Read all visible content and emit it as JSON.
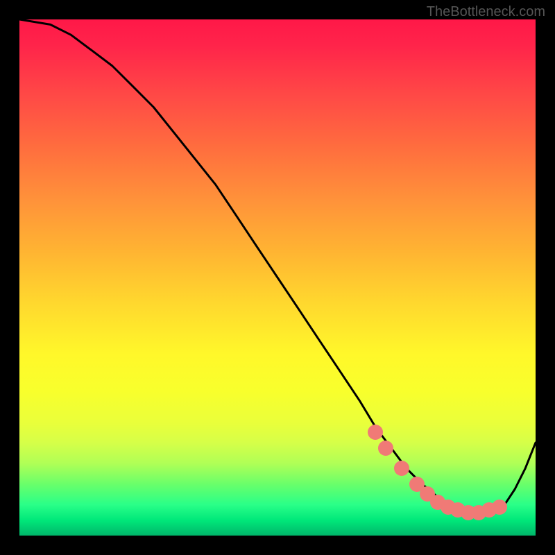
{
  "watermark": "TheBottleneck.com",
  "chart_data": {
    "type": "line",
    "title": "",
    "xlabel": "",
    "ylabel": "",
    "xlim": [
      0,
      100
    ],
    "ylim": [
      0,
      100
    ],
    "series": [
      {
        "name": "curve",
        "x": [
          0,
          6,
          10,
          14,
          18,
          22,
          26,
          30,
          34,
          38,
          42,
          46,
          50,
          54,
          58,
          62,
          66,
          69,
          72,
          75,
          78,
          81,
          84,
          86,
          88,
          90,
          92,
          94,
          96,
          98,
          100
        ],
        "values": [
          100,
          99,
          97,
          94,
          91,
          87,
          83,
          78,
          73,
          68,
          62,
          56,
          50,
          44,
          38,
          32,
          26,
          21,
          17,
          13,
          10,
          7.5,
          5.5,
          4.5,
          4,
          4,
          4.5,
          6,
          9,
          13,
          18
        ]
      }
    ],
    "markers": {
      "name": "highlight-dots",
      "x": [
        69,
        71,
        74,
        77,
        79,
        81,
        83,
        85,
        87,
        89,
        91,
        93
      ],
      "values": [
        20,
        17,
        13,
        10,
        8,
        6.5,
        5.5,
        5,
        4.5,
        4.5,
        5,
        5.5
      ]
    },
    "gradient_stops": [
      {
        "pos": 0,
        "color": "#ff1848"
      },
      {
        "pos": 50,
        "color": "#ffd82e"
      },
      {
        "pos": 90,
        "color": "#6aff6a"
      },
      {
        "pos": 100,
        "color": "#00b66a"
      }
    ]
  }
}
